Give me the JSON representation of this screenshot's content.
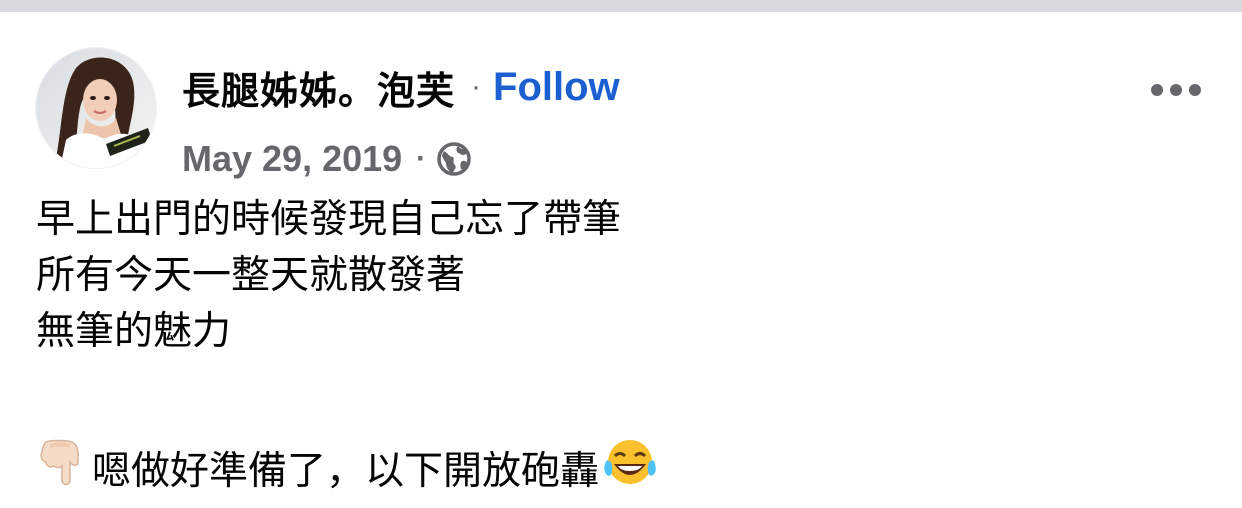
{
  "post": {
    "author_name": "長腿姊姊。泡芙",
    "separator": "·",
    "follow_label": "Follow",
    "date": "May 29, 2019",
    "meta_separator": "·",
    "privacy_icon": "globe-icon",
    "more_icon": "more-options-icon",
    "avatar_icon": "profile-photo",
    "text_lines": [
      "早上出門的時候發現自己忘了帶筆",
      "所有今天一整天就散發著",
      "無筆的魅力",
      "",
      "嗯做好準備了，以下開放砲轟"
    ],
    "leading_emoji": "backhand-index-pointing-down",
    "trailing_emoji": "face-with-tears-of-joy",
    "colors": {
      "follow": "#1b5fd1",
      "meta": "#65676b",
      "text": "#050505",
      "top_strip": "#d9dadd"
    }
  }
}
